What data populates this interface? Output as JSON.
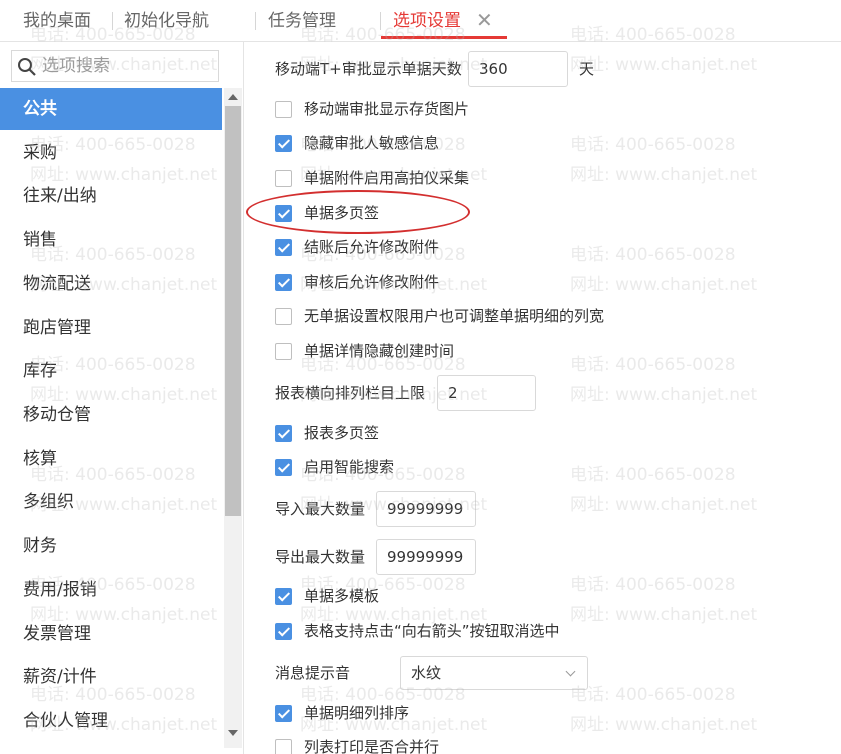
{
  "tabs": [
    {
      "label": "我的桌面",
      "active": false
    },
    {
      "label": "初始化导航",
      "active": false
    },
    {
      "label": "任务管理",
      "active": false
    },
    {
      "label": "选项设置",
      "active": true
    }
  ],
  "tab_close_glyph": "✕",
  "sidebar": {
    "search_placeholder": "选项搜索",
    "items": [
      {
        "label": "公共",
        "active": true
      },
      {
        "label": "采购"
      },
      {
        "label": "往来/出纳"
      },
      {
        "label": "销售"
      },
      {
        "label": "物流配送"
      },
      {
        "label": "跑店管理"
      },
      {
        "label": "库存"
      },
      {
        "label": "移动仓管"
      },
      {
        "label": "核算"
      },
      {
        "label": "多组织"
      },
      {
        "label": "财务"
      },
      {
        "label": "费用/报销"
      },
      {
        "label": "发票管理"
      },
      {
        "label": "薪资/计件"
      },
      {
        "label": "合伙人管理"
      }
    ]
  },
  "settings": {
    "mobile_days": {
      "label": "移动端T+审批显示单据天数",
      "value": "360",
      "unit": "天"
    },
    "checkboxes_a": [
      {
        "label": "移动端审批显示存货图片",
        "checked": false
      },
      {
        "label": "隐藏审批人敏感信息",
        "checked": true
      },
      {
        "label": "单据附件启用高拍仪采集",
        "checked": false
      },
      {
        "label": "单据多页签",
        "checked": true
      },
      {
        "label": "结账后允许修改附件",
        "checked": true
      },
      {
        "label": "审核后允许修改附件",
        "checked": true
      },
      {
        "label": "无单据设置权限用户也可调整单据明细的列宽",
        "checked": false
      },
      {
        "label": "单据详情隐藏创建时间",
        "checked": false
      }
    ],
    "report_cols": {
      "label": "报表横向排列栏目上限",
      "value": "2"
    },
    "checkboxes_b": [
      {
        "label": "报表多页签",
        "checked": true
      },
      {
        "label": "启用智能搜索",
        "checked": true
      }
    ],
    "import_max": {
      "label": "导入最大数量",
      "value": "99999999"
    },
    "export_max": {
      "label": "导出最大数量",
      "value": "99999999"
    },
    "checkboxes_c": [
      {
        "label": "单据多模板",
        "checked": true
      },
      {
        "label": "表格支持点击“向右箭头”按钮取消选中",
        "checked": true
      }
    ],
    "sound": {
      "label": "消息提示音",
      "value": "水纹"
    },
    "checkboxes_d": [
      {
        "label": "单据明细列排序",
        "checked": true
      },
      {
        "label": "列表打印是否合并行",
        "checked": false
      }
    ]
  },
  "watermark": {
    "phone": "电话: 400-665-0028",
    "site": "网址: www.chanjet.net"
  },
  "colors": {
    "accent": "#4a90e2",
    "active_tab": "#e53935",
    "annotation": "#d32f2f"
  }
}
